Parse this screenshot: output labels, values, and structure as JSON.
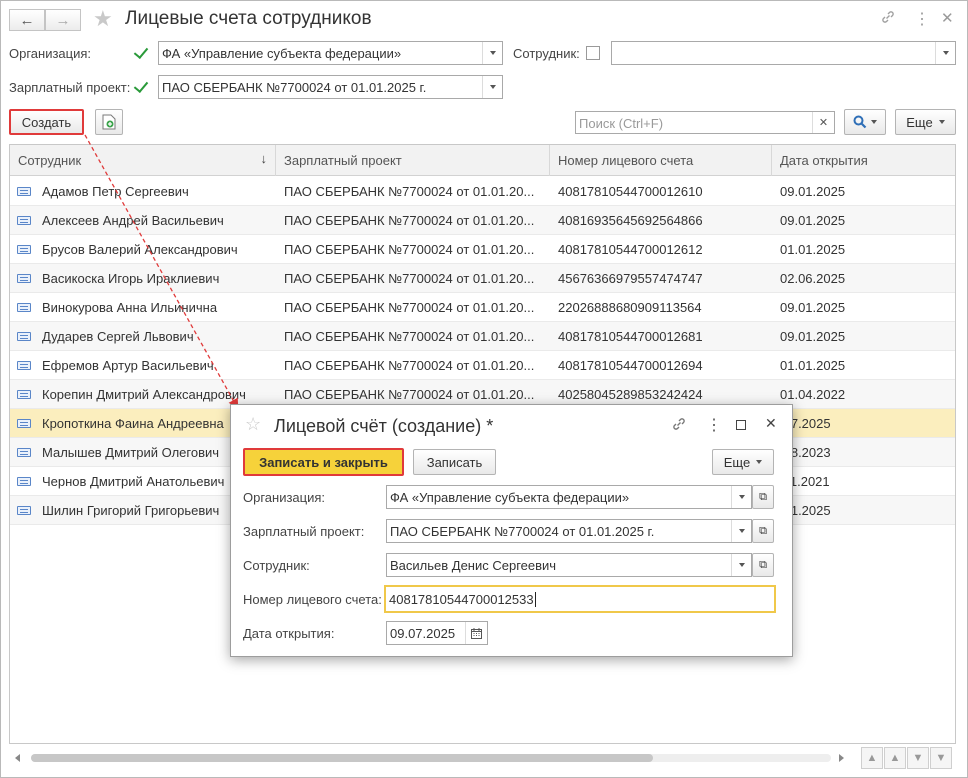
{
  "window": {
    "title": "Лицевые счета сотрудников",
    "back_icon": "arrow-left-icon",
    "forward_icon": "arrow-right-icon"
  },
  "filters": {
    "org_label": "Организация:",
    "org_checked": true,
    "org_value": "ФА «Управление субъекта федерации»",
    "employee_label": "Сотрудник:",
    "employee_checked": false,
    "employee_value": "",
    "project_label": "Зарплатный проект:",
    "project_checked": true,
    "project_value": "ПАО СБЕРБАНК №7700024 от 01.01.2025 г."
  },
  "toolbar": {
    "create_label": "Создать",
    "search_placeholder": "Поиск (Ctrl+F)",
    "more_label": "Еще"
  },
  "table": {
    "columns": [
      "Сотрудник",
      "Зарплатный проект",
      "Номер лицевого счета",
      "Дата открытия"
    ],
    "rows": [
      {
        "employee": "Адамов Петр Сергеевич",
        "project": "ПАО СБЕРБАНК №7700024 от 01.01.20...",
        "account": "40817810544700012610",
        "date": "09.01.2025"
      },
      {
        "employee": "Алексеев Андрей Васильевич",
        "project": "ПАО СБЕРБАНК №7700024 от 01.01.20...",
        "account": "40816935645692564866",
        "date": "09.01.2025"
      },
      {
        "employee": "Брусов Валерий Александрович",
        "project": "ПАО СБЕРБАНК №7700024 от 01.01.20...",
        "account": "40817810544700012612",
        "date": "01.01.2025"
      },
      {
        "employee": "Васикоска Игорь Ираклиевич",
        "project": "ПАО СБЕРБАНК №7700024 от 01.01.20...",
        "account": "45676366979557474747",
        "date": "02.06.2025"
      },
      {
        "employee": "Винокурова Анна Ильинична",
        "project": "ПАО СБЕРБАНК №7700024 от 01.01.20...",
        "account": "22026888680909113564",
        "date": "09.01.2025"
      },
      {
        "employee": "Дударев Сергей Львович",
        "project": "ПАО СБЕРБАНК №7700024 от 01.01.20...",
        "account": "40817810544700012681",
        "date": "09.01.2025"
      },
      {
        "employee": "Ефремов Артур Васильевич",
        "project": "ПАО СБЕРБАНК №7700024 от 01.01.20...",
        "account": "40817810544700012694",
        "date": "01.01.2025"
      },
      {
        "employee": "Корепин Дмитрий Александрович",
        "project": "ПАО СБЕРБАНК №7700024 от 01.01.20...",
        "account": "40258045289853242424",
        "date": "01.04.2022"
      },
      {
        "employee": "Кропоткина Фаина Андреевна",
        "project": "",
        "account": "",
        "date": ".07.2025"
      },
      {
        "employee": "Малышев Дмитрий Олегович",
        "project": "",
        "account": "",
        "date": ".08.2023"
      },
      {
        "employee": "Чернов Дмитрий Анатольевич",
        "project": "",
        "account": "",
        "date": ".11.2021"
      },
      {
        "employee": "Шилин Григорий Григорьевич",
        "project": "",
        "account": "",
        "date": ".01.2025"
      }
    ]
  },
  "dialog": {
    "title": "Лицевой счёт (создание) *",
    "save_close_label": "Записать и закрыть",
    "save_label": "Записать",
    "more_label": "Еще",
    "org_label": "Организация:",
    "org_value": "ФА «Управление субъекта федерации»",
    "project_label": "Зарплатный проект:",
    "project_value": "ПАО СБЕРБАНК №7700024 от 01.01.2025 г.",
    "employee_label": "Сотрудник:",
    "employee_value": "Васильев Денис Сергеевич",
    "account_label": "Номер лицевого счета:",
    "account_value": "40817810544700012533",
    "date_label": "Дата открытия:",
    "date_value": "09.07.2025"
  },
  "colors": {
    "highlight_red": "#e03a3a",
    "primary_yellow": "#f6d23a",
    "selected_row": "#fbeebe",
    "checkbox_green": "#2a9a3a"
  }
}
